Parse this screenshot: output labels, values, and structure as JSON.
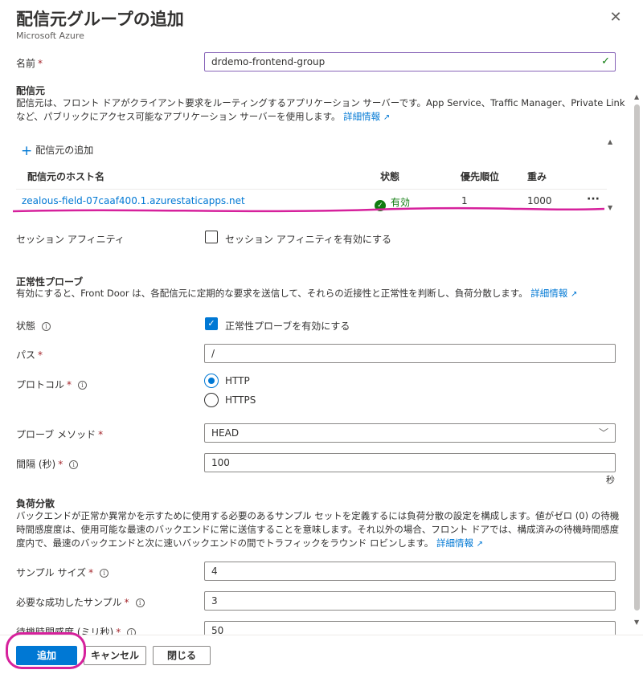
{
  "header": {
    "title": "配信元グループの追加",
    "subtitle": "Microsoft Azure",
    "close_symbol": "✕"
  },
  "name_field": {
    "label": "名前",
    "required_mark": "*",
    "value": "drdemo-frontend-group"
  },
  "origins": {
    "title": "配信元",
    "description": "配信元は、フロント ドアがクライアント要求をルーティングするアプリケーション サーバーです。App Service、Traffic Manager、Private Link など、パブリックにアクセス可能なアプリケーション サーバーを使用します。",
    "learn_more": "詳細情報",
    "add_label": "配信元の追加",
    "columns": {
      "host": "配信元のホスト名",
      "status": "状態",
      "priority": "優先順位",
      "weight": "重み"
    },
    "rows": [
      {
        "host": "zealous-field-07caaf400.1.azurestaticapps.net",
        "status": "有効",
        "priority": "1",
        "weight": "1000"
      }
    ],
    "more_symbol": "···"
  },
  "session_affinity": {
    "label": "セッション アフィニティ",
    "checkbox_label": "セッション アフィニティを有効にする",
    "checked": false
  },
  "health_probe": {
    "title": "正常性プローブ",
    "description": "有効にすると、Front Door は、各配信元に定期的な要求を送信して、それらの近接性と正常性を判断し、負荷分散します。",
    "learn_more": "詳細情報",
    "status_label": "状態",
    "status_checkbox_label": "正常性プローブを有効にする",
    "path_label": "パス",
    "path_value": "/",
    "protocol_label": "プロトコル",
    "protocol_options": [
      "HTTP",
      "HTTPS"
    ],
    "protocol_selected": "HTTP",
    "method_label": "プローブ メソッド",
    "method_value": "HEAD",
    "interval_label": "間隔 (秒)",
    "interval_value": "100",
    "interval_unit": "秒"
  },
  "load_balancing": {
    "title": "負荷分散",
    "description": "バックエンドが正常か異常かを示すために使用する必要のあるサンプル セットを定義するには負荷分散の設定を構成します。値がゼロ (0) の待機時間感度度は、使用可能な最速のバックエンドに常に送信することを意味します。それ以外の場合、フロント ドアでは、構成済みの待機時間感度度内で、最速のバックエンドと次に速いバックエンドの間でトラフィックをラウンド ロビンします。",
    "learn_more": "詳細情報",
    "sample_size_label": "サンプル サイズ",
    "sample_size_value": "4",
    "success_label": "必要な成功したサンプル",
    "success_value": "3",
    "latency_label": "待機時間感度 (ミリ秒)",
    "latency_value": "50"
  },
  "footer": {
    "add": "追加",
    "cancel": "キャンセル",
    "close": "閉じる"
  },
  "colors": {
    "accent": "#0078d4",
    "success": "#107c10",
    "annotation": "#d6219c"
  }
}
